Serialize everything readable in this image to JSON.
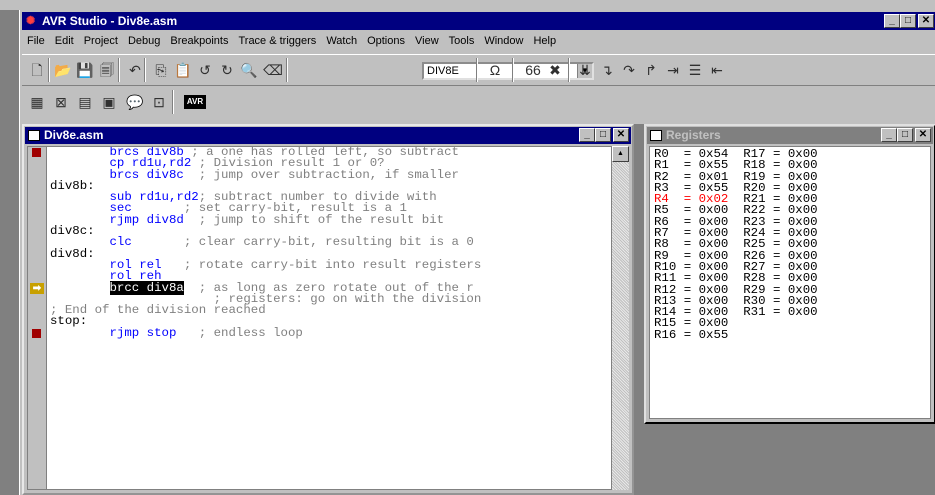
{
  "window": {
    "title": "AVR Studio - Div8e.asm",
    "controls": [
      "_",
      "□",
      "✕"
    ]
  },
  "menu": [
    "File",
    "Edit",
    "Project",
    "Debug",
    "Breakpoints",
    "Trace & triggers",
    "Watch",
    "Options",
    "View",
    "Tools",
    "Window",
    "Help"
  ],
  "toolbar": {
    "target_combo": "DIV8E",
    "icons": [
      "new-file-icon",
      "open-folder-icon",
      "save-icon",
      "save-all-icon",
      "undo-icon",
      "copy-icon",
      "paste-icon",
      "undo-arrow-icon",
      "redo-arrow-icon",
      "find-icon",
      "clear-icon",
      "omega-icon",
      "watch-icon",
      "clear-watch-icon",
      "run-icon",
      "step-into-icon",
      "step-over-icon",
      "step-out-icon",
      "run-to-cursor-icon",
      "toggle-breakpoint-icon",
      "trace-icon"
    ],
    "row2_icons": [
      "memory-window-icon",
      "io-window-icon",
      "registers-window-icon",
      "processor-window-icon",
      "message-icon",
      "watch-window-icon",
      "avr-chip-icon"
    ],
    "avr_label": "AVR"
  },
  "editor": {
    "title": "Div8e.asm",
    "lines": [
      {
        "indent": "        ",
        "kw": "brcs div8b",
        "cm": " ; a one has rolled left, so subtract",
        "hl": "",
        "label": "",
        "bp": true,
        "ip": false
      },
      {
        "indent": "        ",
        "kw": "cp rd1u,rd2",
        "cm": " ; Division result 1 or 0?",
        "hl": "",
        "label": "",
        "bp": false,
        "ip": false
      },
      {
        "indent": "        ",
        "kw": "brcs div8c",
        "cm": "  ; jump over subtraction, if smaller",
        "hl": "",
        "label": "",
        "bp": false,
        "ip": false
      },
      {
        "indent": "",
        "kw": "",
        "cm": "",
        "hl": "",
        "label": "div8b:",
        "bp": false,
        "ip": false
      },
      {
        "indent": "        ",
        "kw": "sub rd1u,rd2",
        "cm": "; subtract number to divide with",
        "hl": "",
        "label": "",
        "bp": false,
        "ip": false
      },
      {
        "indent": "        ",
        "kw": "sec",
        "cm": "       ; set carry-bit, result is a 1",
        "hl": "",
        "label": "",
        "bp": false,
        "ip": false
      },
      {
        "indent": "        ",
        "kw": "rjmp div8d",
        "cm": "  ; jump to shift of the result bit",
        "hl": "",
        "label": "",
        "bp": false,
        "ip": false
      },
      {
        "indent": "",
        "kw": "",
        "cm": "",
        "hl": "",
        "label": "div8c:",
        "bp": false,
        "ip": false
      },
      {
        "indent": "        ",
        "kw": "clc",
        "cm": "       ; clear carry-bit, resulting bit is a 0",
        "hl": "",
        "label": "",
        "bp": false,
        "ip": false
      },
      {
        "indent": "",
        "kw": "",
        "cm": "",
        "hl": "",
        "label": "div8d:",
        "bp": false,
        "ip": false
      },
      {
        "indent": "        ",
        "kw": "rol rel",
        "cm": "   ; rotate carry-bit into result registers",
        "hl": "",
        "label": "",
        "bp": false,
        "ip": false
      },
      {
        "indent": "        ",
        "kw": "rol reh",
        "cm": "",
        "hl": "",
        "label": "",
        "bp": false,
        "ip": false
      },
      {
        "indent": "        ",
        "kw": "",
        "cm": "  ; as long as zero rotate out of the r",
        "hl": "brcc div8a",
        "label": "",
        "bp": false,
        "ip": true
      },
      {
        "indent": "        ",
        "kw": "",
        "cm": "              ; registers: go on with the division",
        "hl": "",
        "label": "",
        "bp": false,
        "ip": false
      },
      {
        "indent": "",
        "kw": "",
        "cm": "; End of the division reached",
        "hl": "",
        "label": "",
        "bp": false,
        "ip": false
      },
      {
        "indent": "",
        "kw": "",
        "cm": "",
        "hl": "",
        "label": "stop:",
        "bp": false,
        "ip": false
      },
      {
        "indent": "        ",
        "kw": "rjmp stop",
        "cm": "   ; endless loop",
        "hl": "",
        "label": "",
        "bp": true,
        "ip": false
      }
    ]
  },
  "registers": {
    "title": "Registers",
    "rows": [
      {
        "l": "R0  = 0x54",
        "r": "R17 = 0x00",
        "red": false
      },
      {
        "l": "R1  = 0x55",
        "r": "R18 = 0x00",
        "red": false
      },
      {
        "l": "R2  = 0x01",
        "r": "R19 = 0x00",
        "red": false
      },
      {
        "l": "R3  = 0x55",
        "r": "R20 = 0x00",
        "red": false
      },
      {
        "l": "R4  = 0x02",
        "r": "R21 = 0x00",
        "red": true
      },
      {
        "l": "R5  = 0x00",
        "r": "R22 = 0x00",
        "red": false
      },
      {
        "l": "R6  = 0x00",
        "r": "R23 = 0x00",
        "red": false
      },
      {
        "l": "R7  = 0x00",
        "r": "R24 = 0x00",
        "red": false
      },
      {
        "l": "R8  = 0x00",
        "r": "R25 = 0x00",
        "red": false
      },
      {
        "l": "R9  = 0x00",
        "r": "R26 = 0x00",
        "red": false
      },
      {
        "l": "R10 = 0x00",
        "r": "R27 = 0x00",
        "red": false
      },
      {
        "l": "R11 = 0x00",
        "r": "R28 = 0x00",
        "red": false
      },
      {
        "l": "R12 = 0x00",
        "r": "R29 = 0x00",
        "red": false
      },
      {
        "l": "R13 = 0x00",
        "r": "R30 = 0x00",
        "red": false
      },
      {
        "l": "R14 = 0x00",
        "r": "R31 = 0x00",
        "red": false
      },
      {
        "l": "R15 = 0x00",
        "r": "",
        "red": false
      },
      {
        "l": "R16 = 0x55",
        "r": "",
        "red": false
      }
    ]
  },
  "colors": {
    "active_title": "#000080",
    "inactive_title": "#808080",
    "keyword": "#0000ff",
    "comment": "#808080",
    "changed_register": "#ff0000",
    "breakpoint": "#a00000",
    "instruction_pointer": "#c8a000"
  }
}
